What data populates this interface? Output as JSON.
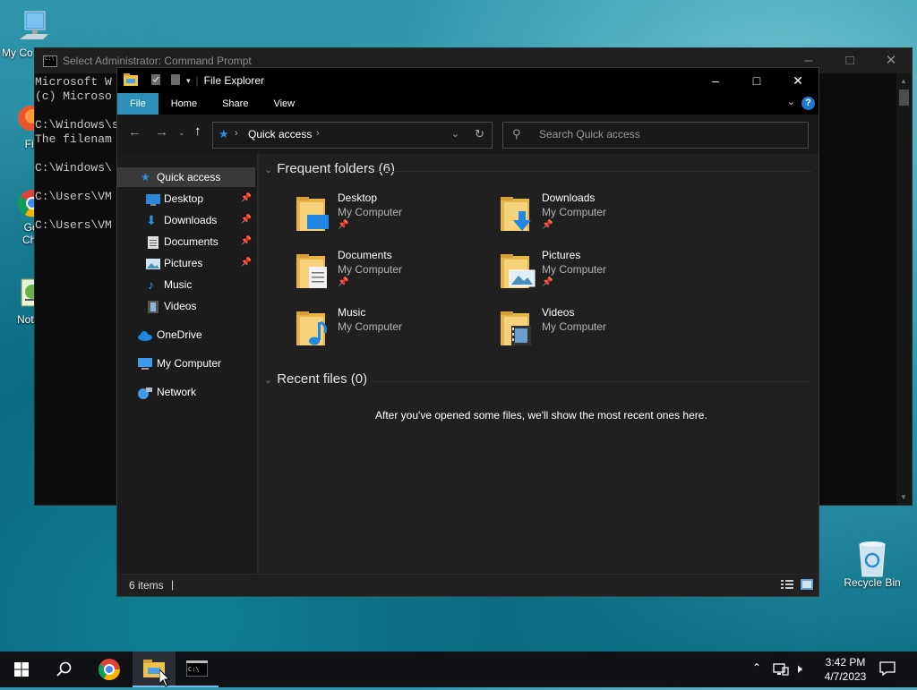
{
  "desktop": {
    "icons": [
      {
        "label": "My Co",
        "icon": "my-computer-icon"
      },
      {
        "label": "Fire",
        "icon": "firefox-icon"
      },
      {
        "label": "Goo",
        "label2": "Chro",
        "icon": "chrome-icon"
      },
      {
        "label": "Notep",
        "icon": "notepad-icon"
      },
      {
        "label": "Recycle Bin",
        "icon": "recycle-bin-icon"
      }
    ]
  },
  "cmd": {
    "title": "Select Administrator: Command Prompt",
    "lines": [
      "Microsoft W",
      "(c) Microso",
      "",
      "C:\\Windows\\s",
      "The filenam",
      "",
      "C:\\Windows\\",
      "",
      "C:\\Users\\VM",
      "",
      "C:\\Users\\VM"
    ]
  },
  "explorer": {
    "title": "File Explorer",
    "ribbon_tabs": [
      "File",
      "Home",
      "Share",
      "View"
    ],
    "address": {
      "location": "Quick access",
      "search_placeholder": "Search Quick access"
    },
    "nav": {
      "quick_access": "Quick access",
      "items": [
        {
          "label": "Desktop",
          "pinned": true
        },
        {
          "label": "Downloads",
          "pinned": true
        },
        {
          "label": "Documents",
          "pinned": true
        },
        {
          "label": "Pictures",
          "pinned": true
        },
        {
          "label": "Music",
          "pinned": false
        },
        {
          "label": "Videos",
          "pinned": false
        }
      ],
      "onedrive": "OneDrive",
      "my_computer": "My Computer",
      "network": "Network"
    },
    "frequent": {
      "header": "Frequent folders (6)",
      "folders": [
        {
          "name": "Desktop",
          "location": "My Computer",
          "pinned": true
        },
        {
          "name": "Downloads",
          "location": "My Computer",
          "pinned": true
        },
        {
          "name": "Documents",
          "location": "My Computer",
          "pinned": true
        },
        {
          "name": "Pictures",
          "location": "My Computer",
          "pinned": true
        },
        {
          "name": "Music",
          "location": "My Computer",
          "pinned": false
        },
        {
          "name": "Videos",
          "location": "My Computer",
          "pinned": false
        }
      ]
    },
    "recent": {
      "header": "Recent files (0)",
      "empty_message": "After you've opened some files, we'll show the most recent ones here."
    },
    "status": {
      "item_count": "6 items"
    }
  },
  "taskbar": {
    "time": "3:42 PM",
    "date": "4/7/2023"
  }
}
